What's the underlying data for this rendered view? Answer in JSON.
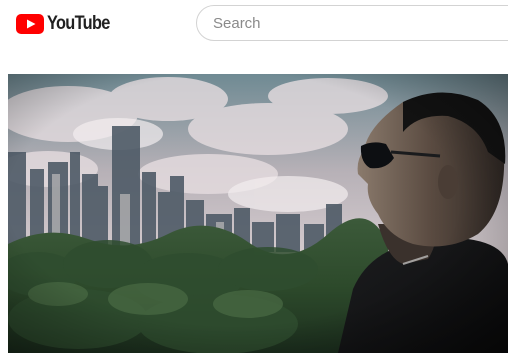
{
  "header": {
    "logo_text": "YouTube",
    "logo_icon": "youtube-play-icon",
    "search": {
      "placeholder": "Search",
      "value": ""
    }
  },
  "colors": {
    "brand_red": "#ff0000",
    "text_dark": "#212121",
    "search_border": "#d3d3d3"
  },
  "video": {
    "thumbnail_icon": "video-frame"
  }
}
